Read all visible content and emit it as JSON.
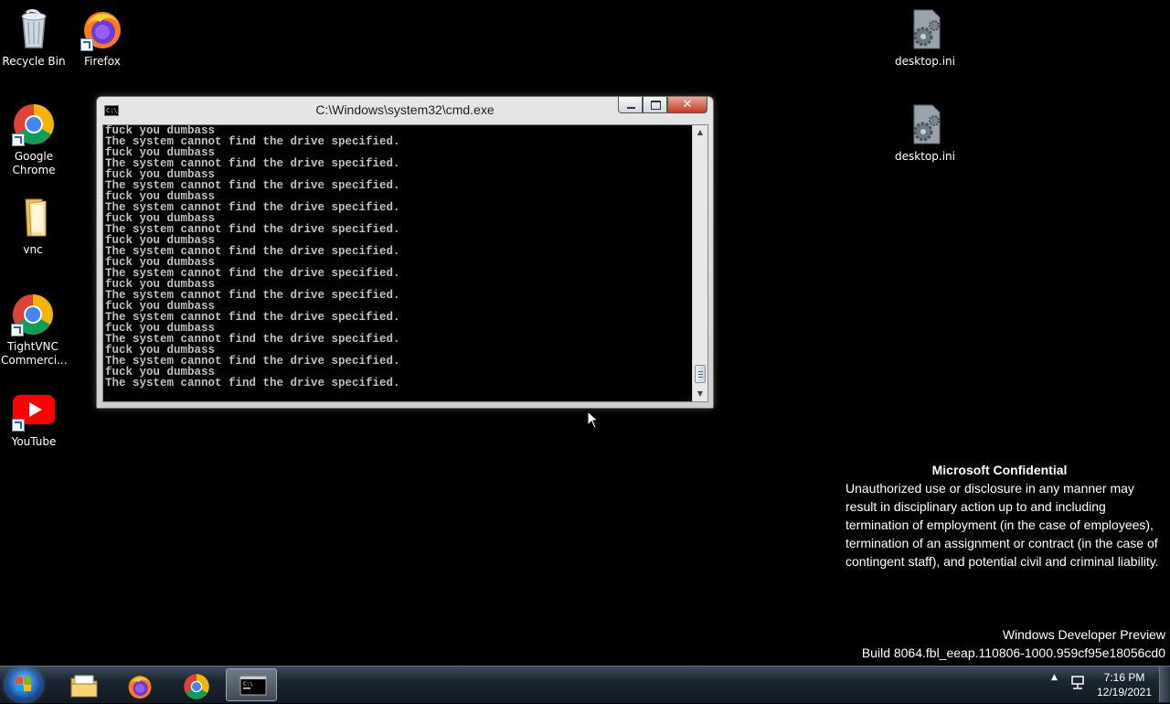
{
  "desktop": {
    "icons": [
      {
        "label": "Recycle Bin"
      },
      {
        "label": "Firefox"
      },
      {
        "label": "Google Chrome"
      },
      {
        "label": "vnc"
      },
      {
        "label": "TightVNC Commerci..."
      },
      {
        "label": "YouTube"
      },
      {
        "label": "desktop.ini"
      },
      {
        "label": "desktop.ini"
      }
    ]
  },
  "cmd": {
    "title": "C:\\Windows\\system32\\cmd.exe",
    "icon_text": "C:\\.",
    "buttons": {
      "minimize": "minimize-icon",
      "maximize": "maximize-icon",
      "close": "close-icon"
    },
    "lines": [
      "fuck you dumbass",
      "The system cannot find the drive specified.",
      "fuck you dumbass",
      "The system cannot find the drive specified.",
      "fuck you dumbass",
      "The system cannot find the drive specified.",
      "fuck you dumbass",
      "The system cannot find the drive specified.",
      "fuck you dumbass",
      "The system cannot find the drive specified.",
      "fuck you dumbass",
      "The system cannot find the drive specified.",
      "fuck you dumbass",
      "The system cannot find the drive specified.",
      "fuck you dumbass",
      "The system cannot find the drive specified.",
      "fuck you dumbass",
      "The system cannot find the drive specified.",
      "fuck you dumbass",
      "The system cannot find the drive specified.",
      "fuck you dumbass",
      "The system cannot find the drive specified.",
      "fuck you dumbass",
      "The system cannot find the drive specified."
    ]
  },
  "confidential": {
    "heading": "Microsoft Confidential",
    "body": "Unauthorized use or disclosure in any manner may result in disciplinary action up to and including termination of employment (in the case of employees), termination of an assignment or contract (in the case of contingent staff), and potential civil and criminal liability."
  },
  "build": {
    "line1": "Windows Developer Preview",
    "line2": "Build 8064.fbl_eeap.110806-1000.959cf95e18056cd0"
  },
  "taskbar": {
    "items": [
      "windows-explorer-icon",
      "firefox-icon",
      "chrome-icon",
      "cmd-icon"
    ],
    "active": "cmd-icon"
  },
  "clock": {
    "time": "7:16 PM",
    "date": "12/19/2021"
  },
  "colors": {
    "desktop_bg": "#000000",
    "console_text": "#c0c0c0",
    "close_red": "#c43b1f"
  }
}
